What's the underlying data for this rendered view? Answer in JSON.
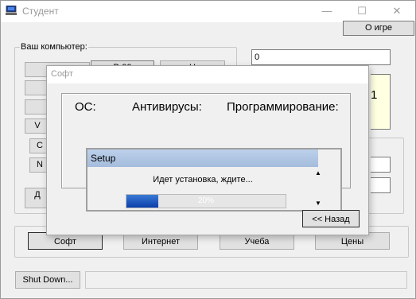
{
  "window": {
    "title": "Студент",
    "minimize": "—",
    "maximize": "☐",
    "close": "✕"
  },
  "about_label": "О игре",
  "computer_group": {
    "legend": "Ваш компьютер:",
    "buttons": [
      "Пр",
      "Р-99",
      "Н",
      "",
      "",
      "",
      "V",
      "С",
      "N",
      "Д"
    ]
  },
  "money_value": "0",
  "yellow_value": "1",
  "bottom_nav": {
    "soft": "Софт",
    "internet": "Интернет",
    "study": "Учеба",
    "prices": "Цены"
  },
  "shutdown_label": "Shut Down...",
  "dialog": {
    "title": "Софт",
    "categories": {
      "os": "ОС:",
      "antivirus": "Антивирусы:",
      "programming": "Программирование:"
    },
    "setup": {
      "header": "Setup",
      "message": "Идет установка, ждите...",
      "progress_percent": 20,
      "progress_text": "20%"
    },
    "back_label": "<< Назад"
  }
}
